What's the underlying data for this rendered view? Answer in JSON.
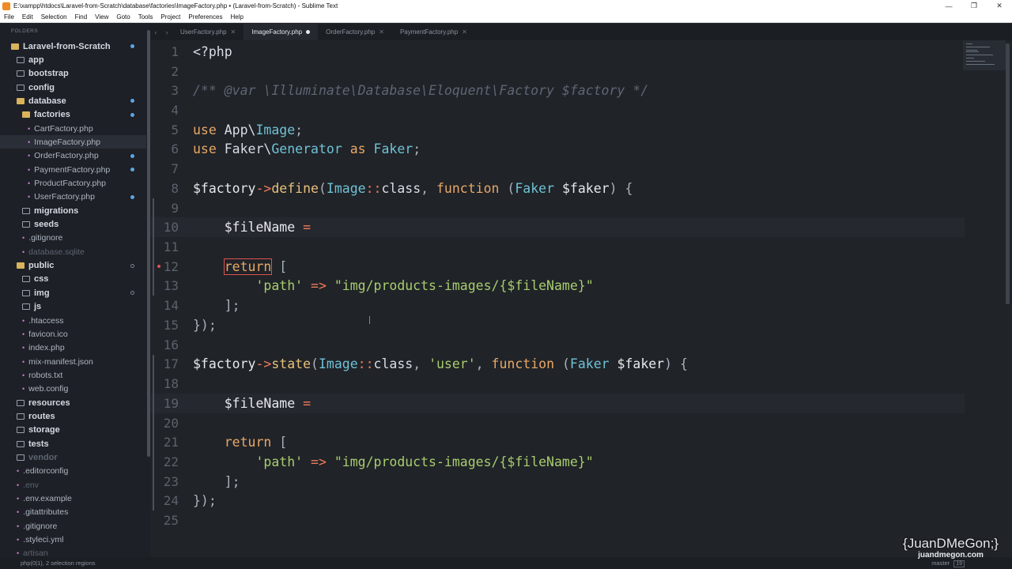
{
  "window": {
    "title": "E:\\xampp\\htdocs\\Laravel-from-Scratch\\database\\factories\\ImageFactory.php • (Laravel-from-Scratch) - Sublime Text",
    "minimize": "—",
    "maximize": "❐",
    "close": "✕"
  },
  "menu": [
    "File",
    "Edit",
    "Selection",
    "Find",
    "View",
    "Goto",
    "Tools",
    "Project",
    "Preferences",
    "Help"
  ],
  "sidebar": {
    "header": "FOLDERS",
    "items": [
      {
        "label": "Laravel-from-Scratch",
        "kind": "root"
      },
      {
        "label": "app",
        "kind": "folder"
      },
      {
        "label": "bootstrap",
        "kind": "folder"
      },
      {
        "label": "config",
        "kind": "folder"
      },
      {
        "label": "database",
        "kind": "folder-open"
      },
      {
        "label": "factories",
        "kind": "folder-open"
      },
      {
        "label": "CartFactory.php",
        "kind": "file"
      },
      {
        "label": "ImageFactory.php",
        "kind": "file-selected"
      },
      {
        "label": "OrderFactory.php",
        "kind": "file"
      },
      {
        "label": "PaymentFactory.php",
        "kind": "file"
      },
      {
        "label": "ProductFactory.php",
        "kind": "file"
      },
      {
        "label": "UserFactory.php",
        "kind": "file"
      },
      {
        "label": "migrations",
        "kind": "folder"
      },
      {
        "label": "seeds",
        "kind": "folder"
      },
      {
        "label": ".gitignore",
        "kind": "file"
      },
      {
        "label": "database.sqlite",
        "kind": "file-dim"
      },
      {
        "label": "public",
        "kind": "folder-open"
      },
      {
        "label": "css",
        "kind": "folder"
      },
      {
        "label": "img",
        "kind": "folder"
      },
      {
        "label": "js",
        "kind": "folder"
      },
      {
        "label": ".htaccess",
        "kind": "file"
      },
      {
        "label": "favicon.ico",
        "kind": "file"
      },
      {
        "label": "index.php",
        "kind": "file"
      },
      {
        "label": "mix-manifest.json",
        "kind": "file"
      },
      {
        "label": "robots.txt",
        "kind": "file"
      },
      {
        "label": "web.config",
        "kind": "file"
      },
      {
        "label": "resources",
        "kind": "folder"
      },
      {
        "label": "routes",
        "kind": "folder"
      },
      {
        "label": "storage",
        "kind": "folder"
      },
      {
        "label": "tests",
        "kind": "folder"
      },
      {
        "label": "vendor",
        "kind": "folder-dim"
      },
      {
        "label": ".editorconfig",
        "kind": "file"
      },
      {
        "label": ".env",
        "kind": "file-dim"
      },
      {
        "label": ".env.example",
        "kind": "file"
      },
      {
        "label": ".gitattributes",
        "kind": "file"
      },
      {
        "label": ".gitignore",
        "kind": "file"
      },
      {
        "label": ".styleci.yml",
        "kind": "file"
      },
      {
        "label": "artisan",
        "kind": "file-dim"
      }
    ]
  },
  "tabs": [
    {
      "label": "UserFactory.php",
      "active": false
    },
    {
      "label": "ImageFactory.php",
      "active": true
    },
    {
      "label": "OrderFactory.php",
      "active": false
    },
    {
      "label": "PaymentFactory.php",
      "active": false
    }
  ],
  "tab_nav": {
    "prev": "‹",
    "next": "›"
  },
  "editor": {
    "line_numbers": [
      "1",
      "2",
      "3",
      "4",
      "5",
      "6",
      "7",
      "8",
      "9",
      "10",
      "11",
      "12",
      "13",
      "14",
      "15",
      "16",
      "17",
      "18",
      "19",
      "20",
      "21",
      "22",
      "23",
      "24",
      "25"
    ],
    "lines": {
      "l1": "<?php",
      "l3": "/** @var \\Illuminate\\Database\\Eloquent\\Factory $factory */",
      "l5_kw": "use",
      "l5_ns": "App\\",
      "l5_cls": "Image",
      "l5_end": ";",
      "l6_kw": "use",
      "l6_ns": "Faker\\",
      "l6_cls": "Generator",
      "l6_as": "as",
      "l6_alias": "Faker",
      "l6_end": ";",
      "l8_var": "$factory",
      "l8_arrow": "->",
      "l8_fn": "define",
      "l8_p1": "(",
      "l8_cls": "Image",
      "l8_dc": "::",
      "l8_class": "class",
      "l8_comma": ", ",
      "l8_function": "function",
      "l8_p2": " (",
      "l8_type": "Faker",
      "l8_param": " $faker",
      "l8_end": ") {",
      "l10_var": "$fileName",
      "l10_eq": " =",
      "l12_ret": "return",
      "l12_br": " [",
      "l13_key": "'path'",
      "l13_arrow": " => ",
      "l13_val": "\"img/products-images/{$fileName}\"",
      "l14": "];",
      "l15": "});",
      "l17_var": "$factory",
      "l17_arrow": "->",
      "l17_fn": "state",
      "l17_p1": "(",
      "l17_cls": "Image",
      "l17_dc": "::",
      "l17_class": "class",
      "l17_comma": ", ",
      "l17_str": "'user'",
      "l17_comma2": ", ",
      "l17_function": "function",
      "l17_p2": " (",
      "l17_type": "Faker",
      "l17_param": " $faker",
      "l17_end": ") {",
      "l19_var": "$fileName",
      "l19_eq": " =",
      "l21_ret": "return",
      "l21_br": " [",
      "l22_key": "'path'",
      "l22_arrow": " => ",
      "l22_val": "\"img/products-images/{$fileName}\"",
      "l23": "];",
      "l24": "});"
    }
  },
  "status": {
    "left": "php(0|1), 2 selection regions",
    "branch": "master",
    "branch_count": "19"
  },
  "watermark": {
    "name": "{JuanDMeGon;}",
    "url": "juandmegon.com"
  },
  "colors": {
    "accent": "#5fa4e0",
    "error": "#e05252",
    "string": "#a8cd6e",
    "keyword": "#e8a866",
    "class": "#6fc2d6"
  }
}
